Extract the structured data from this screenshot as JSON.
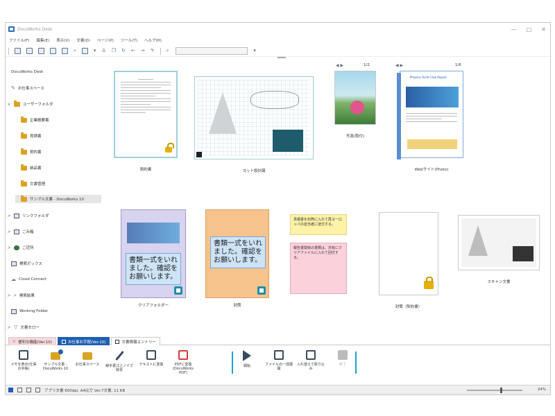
{
  "window": {
    "title": "DocuWorks Desk",
    "controls": [
      "—",
      "□",
      "✕"
    ]
  },
  "menu": [
    "ファイル(F)",
    "編集(E)",
    "表示(V)",
    "文書(D)",
    "ページ(P)",
    "ツール(T)",
    "ヘルプ(H)"
  ],
  "sidebar": {
    "items": [
      {
        "label": "DocuWorks Desk",
        "indent": 0,
        "icon": "none"
      },
      {
        "label": "お仕事スペース",
        "indent": 0,
        "icon": "workspace-icon"
      },
      {
        "label": "ユーザーフォルダ",
        "indent": 0,
        "icon": "folder-icon",
        "chevron": "∨"
      },
      {
        "label": "企業概要書",
        "indent": 1,
        "icon": "folder-icon"
      },
      {
        "label": "見積書",
        "indent": 1,
        "icon": "folder-icon"
      },
      {
        "label": "契約書",
        "indent": 1,
        "icon": "folder-icon"
      },
      {
        "label": "納品書",
        "indent": 1,
        "icon": "folder-icon"
      },
      {
        "label": "文書管理",
        "indent": 1,
        "icon": "folder-icon"
      },
      {
        "label": "サンプル文書 - DocuWorks 10",
        "indent": 1,
        "icon": "folder-icon",
        "selected": true
      },
      {
        "label": "リンクフォルダ",
        "indent": 0,
        "icon": "link-folder-icon",
        "chevron": ">"
      },
      {
        "label": "ごみ箱",
        "indent": 0,
        "icon": "trash-icon",
        "chevron": ">"
      },
      {
        "label": "ご近所",
        "indent": 0,
        "icon": "neighborhood-icon",
        "chevron": ">"
      },
      {
        "label": "検索ボックス",
        "indent": 0,
        "icon": "search-box-icon"
      },
      {
        "label": "Cloud Connect",
        "indent": 0,
        "icon": "cloud-icon"
      },
      {
        "label": "検索結果",
        "indent": 0,
        "icon": "search-icon",
        "chevron": ">"
      },
      {
        "label": "Working Folder",
        "indent": 0,
        "icon": "working-folder-icon"
      },
      {
        "label": "文書セロー",
        "indent": 0,
        "icon": "filter-icon",
        "chevron": ">"
      }
    ]
  },
  "documents": {
    "d1": {
      "caption": "契約書"
    },
    "d2": {
      "caption": "ヨット設計図"
    },
    "d3": {
      "caption": "写真(取付)",
      "pager": "1/2"
    },
    "d4": {
      "caption": "Webサイト(Photo)",
      "pager": "1/6"
    },
    "d5": {
      "caption": "クリアフォルダー",
      "note": "書類一式をいれました。確認をお願いします。"
    },
    "d6": {
      "caption": "封筒",
      "note": "書類一式をいれました。確認をお願いします。"
    },
    "d7": {
      "note": "見積書を封筒に入れて再ヨーロッパの担当者に送付する。"
    },
    "d8": {
      "note": "報告書関係の書類は、共有にクリアファイルに入れて回付する。"
    },
    "d9": {
      "caption": "封筒（契約書）"
    },
    "d10": {
      "caption": "スキャン文書"
    },
    "web_title": "Phoenix Yacht Club Report"
  },
  "tabs": [
    {
      "label": "便利な機能(Ver.10)",
      "style": "pink"
    },
    {
      "label": "お仕事お手軽(Ver.10)",
      "style": "active"
    },
    {
      "label": "文書情報エントリー",
      "style": "normal"
    }
  ],
  "actions": [
    {
      "label": "メモを表示(仕事の手帳)",
      "icon": "memo-icon"
    },
    {
      "label": "サンプル文書 - DocuWorks 10",
      "icon": "folder-icon",
      "badge": true
    },
    {
      "label": "お仕事スペース",
      "icon": "folder-icon"
    },
    {
      "label": "線手書江上ノイズ除去",
      "icon": "pen-icon"
    },
    {
      "label": "テキストに変換",
      "icon": "text-convert-icon"
    },
    {
      "label": "PDFに変換(DocuWorks PDF)",
      "icon": "pdf-icon"
    },
    {
      "label": "開始",
      "icon": "play-icon"
    },
    {
      "label": "ファイルの一括展開",
      "icon": "expand-icon"
    },
    {
      "label": "入れ替えて取り込み",
      "icon": "import-icon"
    },
    {
      "label": "終了",
      "icon": "stop-icon",
      "disabled": true
    }
  ],
  "status": {
    "text": "アプリ文書 600dpi, A4比で Ver.7文書, 11 KB",
    "zoom": "24%",
    "zoom_level": 0.62
  },
  "colors": {
    "accent": "#1f5fb0",
    "separator": "#1aa3c9",
    "selection": "#9bd0d9"
  }
}
